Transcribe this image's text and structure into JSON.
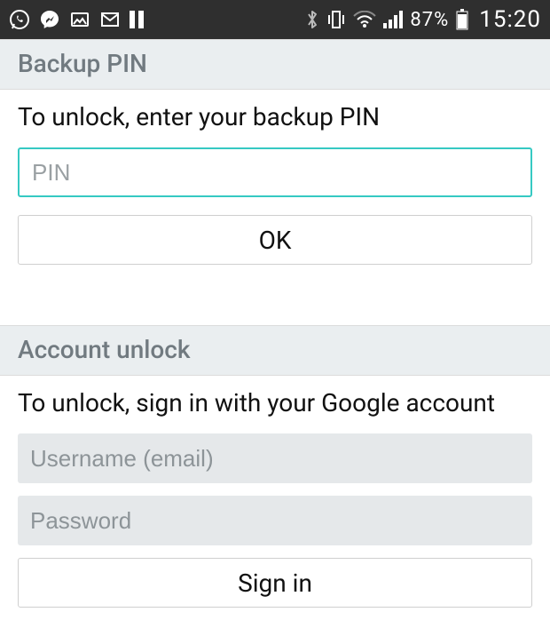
{
  "status_bar": {
    "icons": {
      "whatsapp": "whatsapp-icon",
      "messenger": "messenger-icon",
      "image": "image-icon",
      "gmail": "gmail-icon",
      "pause": "pause-icon",
      "bluetooth": "bluetooth-icon",
      "vibrate": "vibrate-icon",
      "wifi": "wifi-icon",
      "signal": "signal-icon",
      "battery": "battery-icon"
    },
    "battery_pct": "87%",
    "time": "15:20"
  },
  "backup_pin": {
    "header": "Backup PIN",
    "instruction": "To unlock, enter your backup PIN",
    "pin_placeholder": "PIN",
    "pin_value": "",
    "ok_label": "OK"
  },
  "account_unlock": {
    "header": "Account unlock",
    "instruction": "To unlock, sign in with your Google account",
    "username_placeholder": "Username (email)",
    "username_value": "",
    "password_placeholder": "Password",
    "password_value": "",
    "signin_label": "Sign in"
  }
}
